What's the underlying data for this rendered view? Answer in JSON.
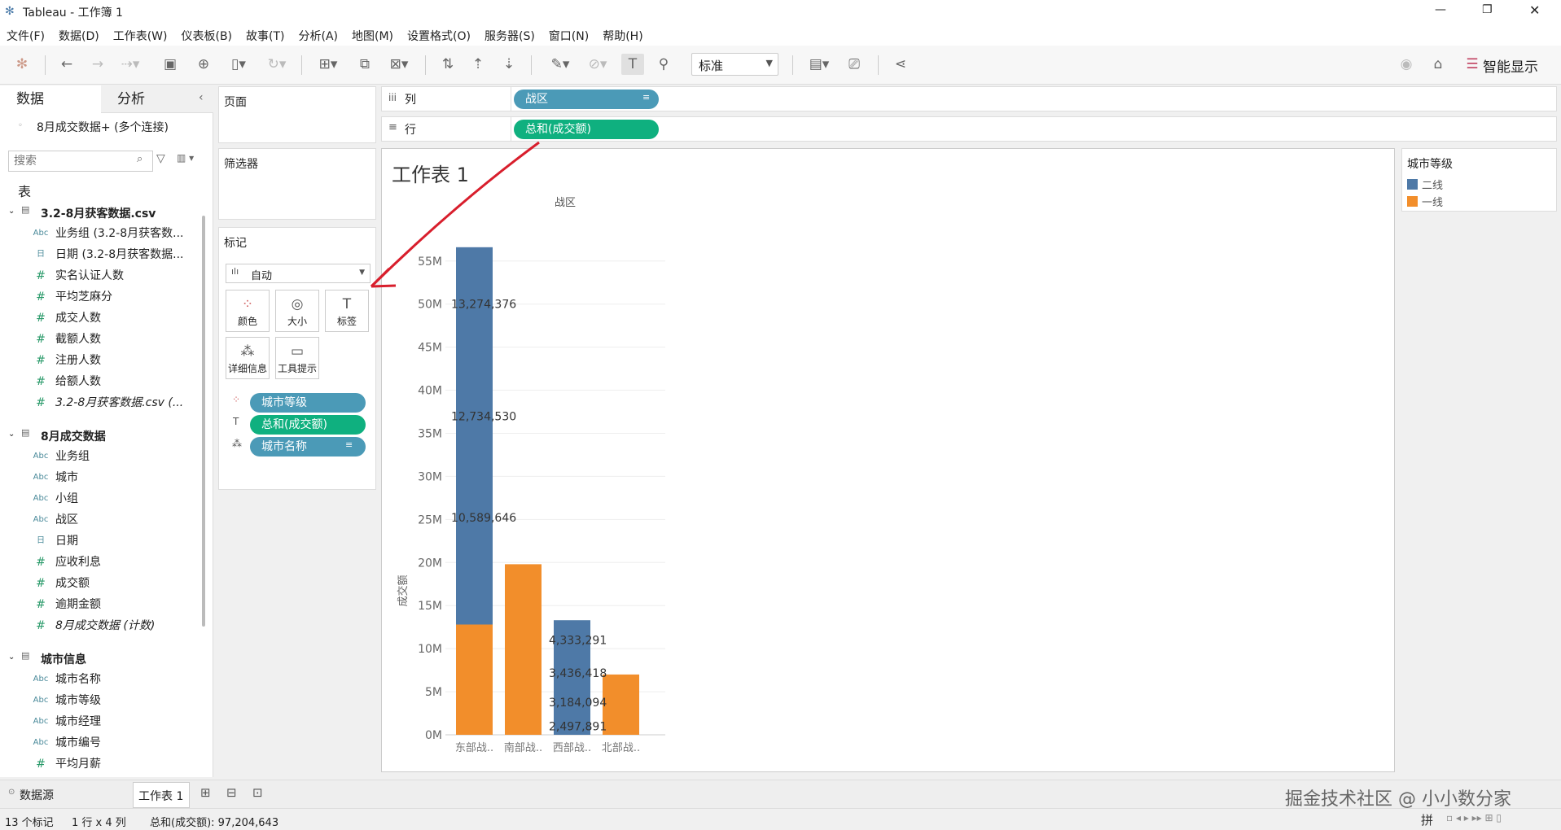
{
  "window": {
    "title": "Tableau - 工作簿 1",
    "minimize": "—",
    "restore": "❐",
    "close": "✕"
  },
  "menu": [
    "文件(F)",
    "数据(D)",
    "工作表(W)",
    "仪表板(B)",
    "故事(T)",
    "分析(A)",
    "地图(M)",
    "设置格式(O)",
    "服务器(S)",
    "窗口(N)",
    "帮助(H)"
  ],
  "toolbar": {
    "fit_value": "标准",
    "show_me_label": "智能显示"
  },
  "left": {
    "tab_data": "数据",
    "tab_analysis": "分析",
    "datasource": "8月成交数据+ (多个连接)",
    "search_placeholder": "搜索",
    "tables_heading": "表",
    "groups": [
      {
        "name": "3.2-8月获客数据.csv",
        "fields": [
          {
            "t": "Abc",
            "n": "业务组 (3.2-8月获客数..."
          },
          {
            "t": "日",
            "n": "日期 (3.2-8月获客数据..."
          },
          {
            "t": "#",
            "n": "实名认证人数"
          },
          {
            "t": "#",
            "n": "平均芝麻分"
          },
          {
            "t": "#",
            "n": "成交人数"
          },
          {
            "t": "#",
            "n": "截额人数"
          },
          {
            "t": "#",
            "n": "注册人数"
          },
          {
            "t": "#",
            "n": "给额人数"
          },
          {
            "t": "#",
            "n": "3.2-8月获客数据.csv (..."
          }
        ]
      },
      {
        "name": "8月成交数据",
        "fields": [
          {
            "t": "Abc",
            "n": "业务组"
          },
          {
            "t": "Abc",
            "n": "城市"
          },
          {
            "t": "Abc",
            "n": "小组"
          },
          {
            "t": "Abc",
            "n": "战区"
          },
          {
            "t": "日",
            "n": "日期"
          },
          {
            "t": "#",
            "n": "应收利息"
          },
          {
            "t": "#",
            "n": "成交额"
          },
          {
            "t": "#",
            "n": "逾期金额"
          },
          {
            "t": "#",
            "n": "8月成交数据 (计数)"
          }
        ]
      },
      {
        "name": "城市信息",
        "fields": [
          {
            "t": "Abc",
            "n": "城市名称"
          },
          {
            "t": "Abc",
            "n": "城市等级"
          },
          {
            "t": "Abc",
            "n": "城市经理"
          },
          {
            "t": "Abc",
            "n": "城市编号"
          },
          {
            "t": "#",
            "n": "平均月薪"
          }
        ]
      }
    ]
  },
  "shelves": {
    "pages": "页面",
    "filters": "筛选器",
    "marks": "标记",
    "marks_type": "自动",
    "columns_label": "列",
    "rows_label": "行",
    "columns_pill": "战区",
    "rows_pill": "总和(成交额)"
  },
  "mark_buttons": [
    "颜色",
    "大小",
    "标签",
    "详细信息",
    "工具提示"
  ],
  "mark_pills": [
    "城市等级",
    "总和(成交额)",
    "城市名称"
  ],
  "sheet": {
    "title": "工作表 1",
    "header": "战区",
    "y_axis_title": "成交额"
  },
  "legend": {
    "title": "城市等级",
    "items": [
      {
        "label": "二线",
        "color": "#4e79a7"
      },
      {
        "label": "一线",
        "color": "#f28e2b"
      }
    ]
  },
  "chart_data": {
    "type": "bar",
    "stacked": true,
    "categories": [
      "东部战..",
      "南部战..",
      "西部战..",
      "北部战.."
    ],
    "series": [
      {
        "name": "一线",
        "color": "#f28e2b",
        "values": [
          12.8,
          19.8,
          0,
          7.0
        ]
      },
      {
        "name": "二线",
        "color": "#4e79a7",
        "values": [
          43.8,
          0,
          13.3,
          0
        ]
      }
    ],
    "ylim": [
      0,
      58
    ],
    "yticks": [
      0,
      5,
      10,
      15,
      20,
      25,
      30,
      35,
      40,
      45,
      50,
      55
    ],
    "ytick_labels": [
      "0M",
      "5M",
      "10M",
      "15M",
      "20M",
      "25M",
      "30M",
      "35M",
      "40M",
      "45M",
      "50M",
      "55M"
    ],
    "data_labels": [
      {
        "cat": 0,
        "y": 50.0,
        "text": "13,274,376"
      },
      {
        "cat": 0,
        "y": 37.0,
        "text": "12,734,530"
      },
      {
        "cat": 0,
        "y": 25.2,
        "text": "10,589,646"
      },
      {
        "cat": 2,
        "y": 11.0,
        "text": "4,333,291"
      },
      {
        "cat": 2,
        "y": 7.2,
        "text": "3,436,418"
      },
      {
        "cat": 2,
        "y": 3.8,
        "text": "3,184,094"
      },
      {
        "cat": 2,
        "y": 1.0,
        "text": "2,497,891"
      }
    ]
  },
  "bottom_tabs": {
    "datasource": "数据源",
    "sheet": "工作表 1"
  },
  "status": {
    "marks": "13 个标记",
    "rows_cols": "1 行 x 4 列",
    "sum": "总和(成交额): 97,204,643"
  },
  "watermark": "掘金技术社区 @ 小小数分家"
}
